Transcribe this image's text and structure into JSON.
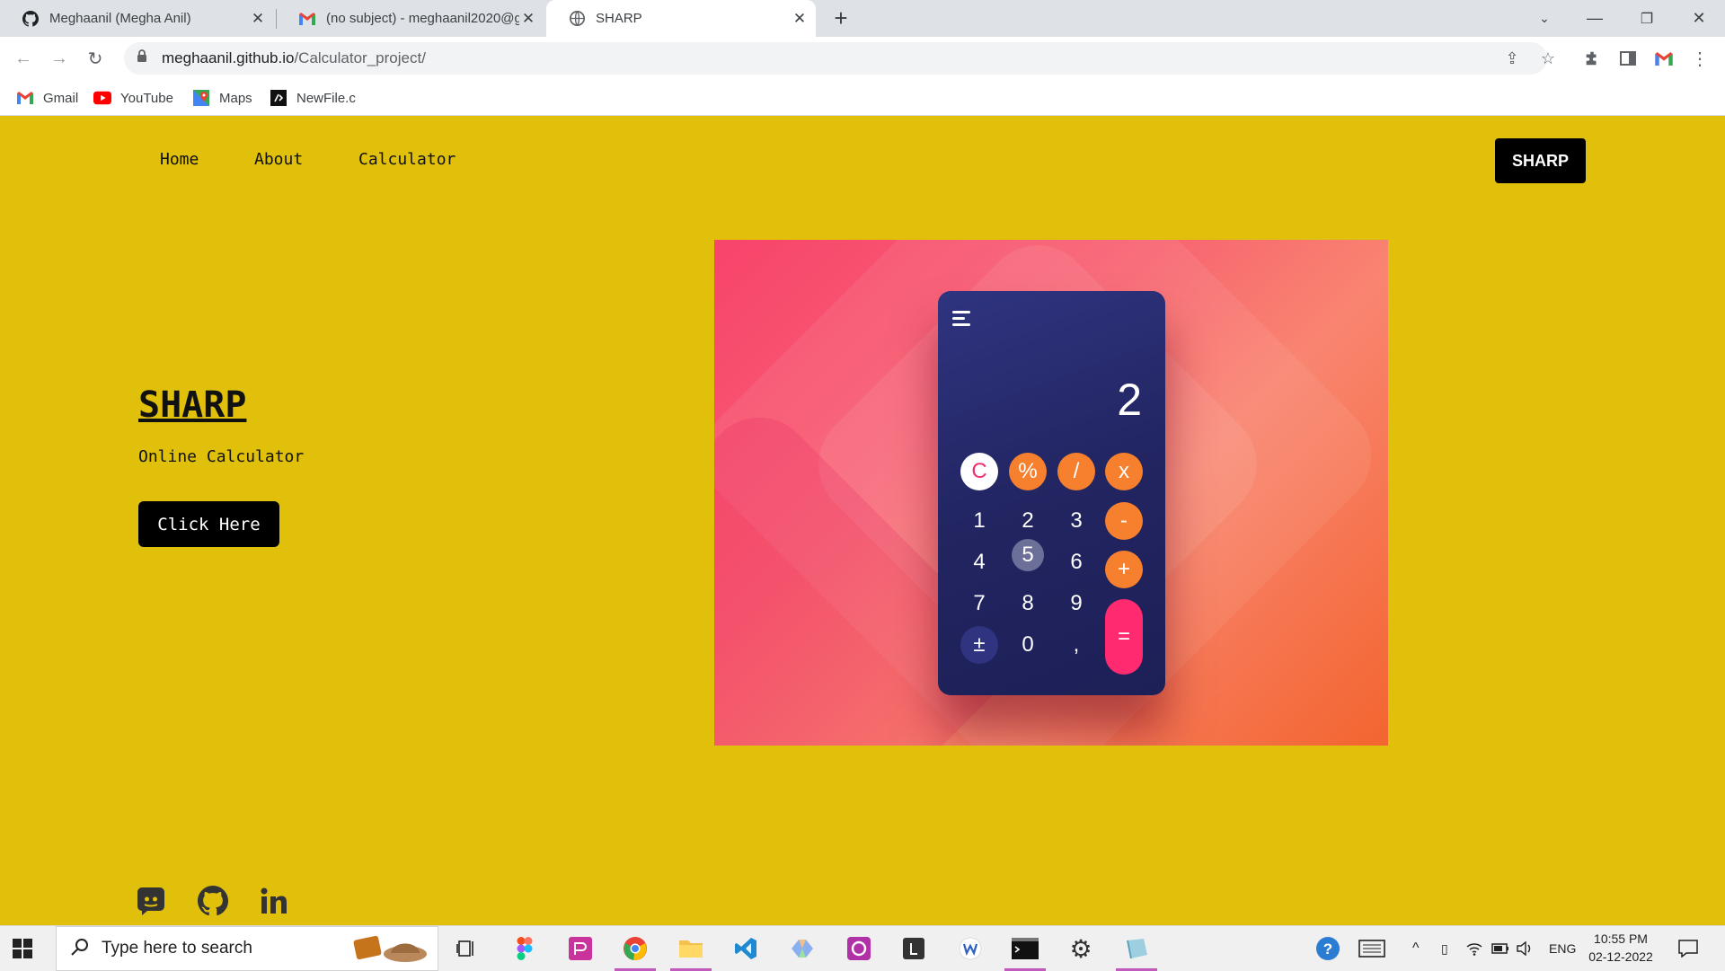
{
  "browser": {
    "tabs": [
      {
        "title": "Meghaanil (Megha Anil)",
        "icon": "github-icon"
      },
      {
        "title": "(no subject) - meghaanil2020@g",
        "icon": "gmail-icon"
      },
      {
        "title": "SHARP",
        "icon": "globe-icon",
        "active": true
      }
    ],
    "url_host": "meghaanil.github.io",
    "url_path": "/Calculator_project/",
    "bookmarks": [
      {
        "label": "Gmail",
        "icon": "gmail-icon"
      },
      {
        "label": "YouTube",
        "icon": "youtube-icon"
      },
      {
        "label": "Maps",
        "icon": "maps-icon"
      },
      {
        "label": "NewFile.c",
        "icon": "code-file-icon"
      }
    ]
  },
  "site": {
    "nav": [
      "Home",
      "About",
      "Calculator"
    ],
    "brand_button": "SHARP",
    "hero": {
      "title": "SHARP",
      "subtitle": "Online Calculator",
      "cta": "Click Here"
    },
    "calculator_image": {
      "display": "2",
      "keys": [
        "C",
        "%",
        "/",
        "x",
        "1",
        "2",
        "3",
        "-",
        "4",
        "5",
        "6",
        "+",
        "7",
        "8",
        "9",
        "=",
        "±",
        "0",
        ","
      ]
    },
    "social": [
      "discord-icon",
      "github-icon",
      "linkedin-icon"
    ]
  },
  "taskbar": {
    "search_placeholder": "Type here to search",
    "language": "ENG",
    "time": "10:55 PM",
    "date": "02-12-2022"
  },
  "colors": {
    "page_bg": "#e0c00a",
    "button_bg": "#000000",
    "calc_orange": "#f6802e",
    "calc_pink": "#ff2a6f",
    "calc_body": "#222561"
  }
}
